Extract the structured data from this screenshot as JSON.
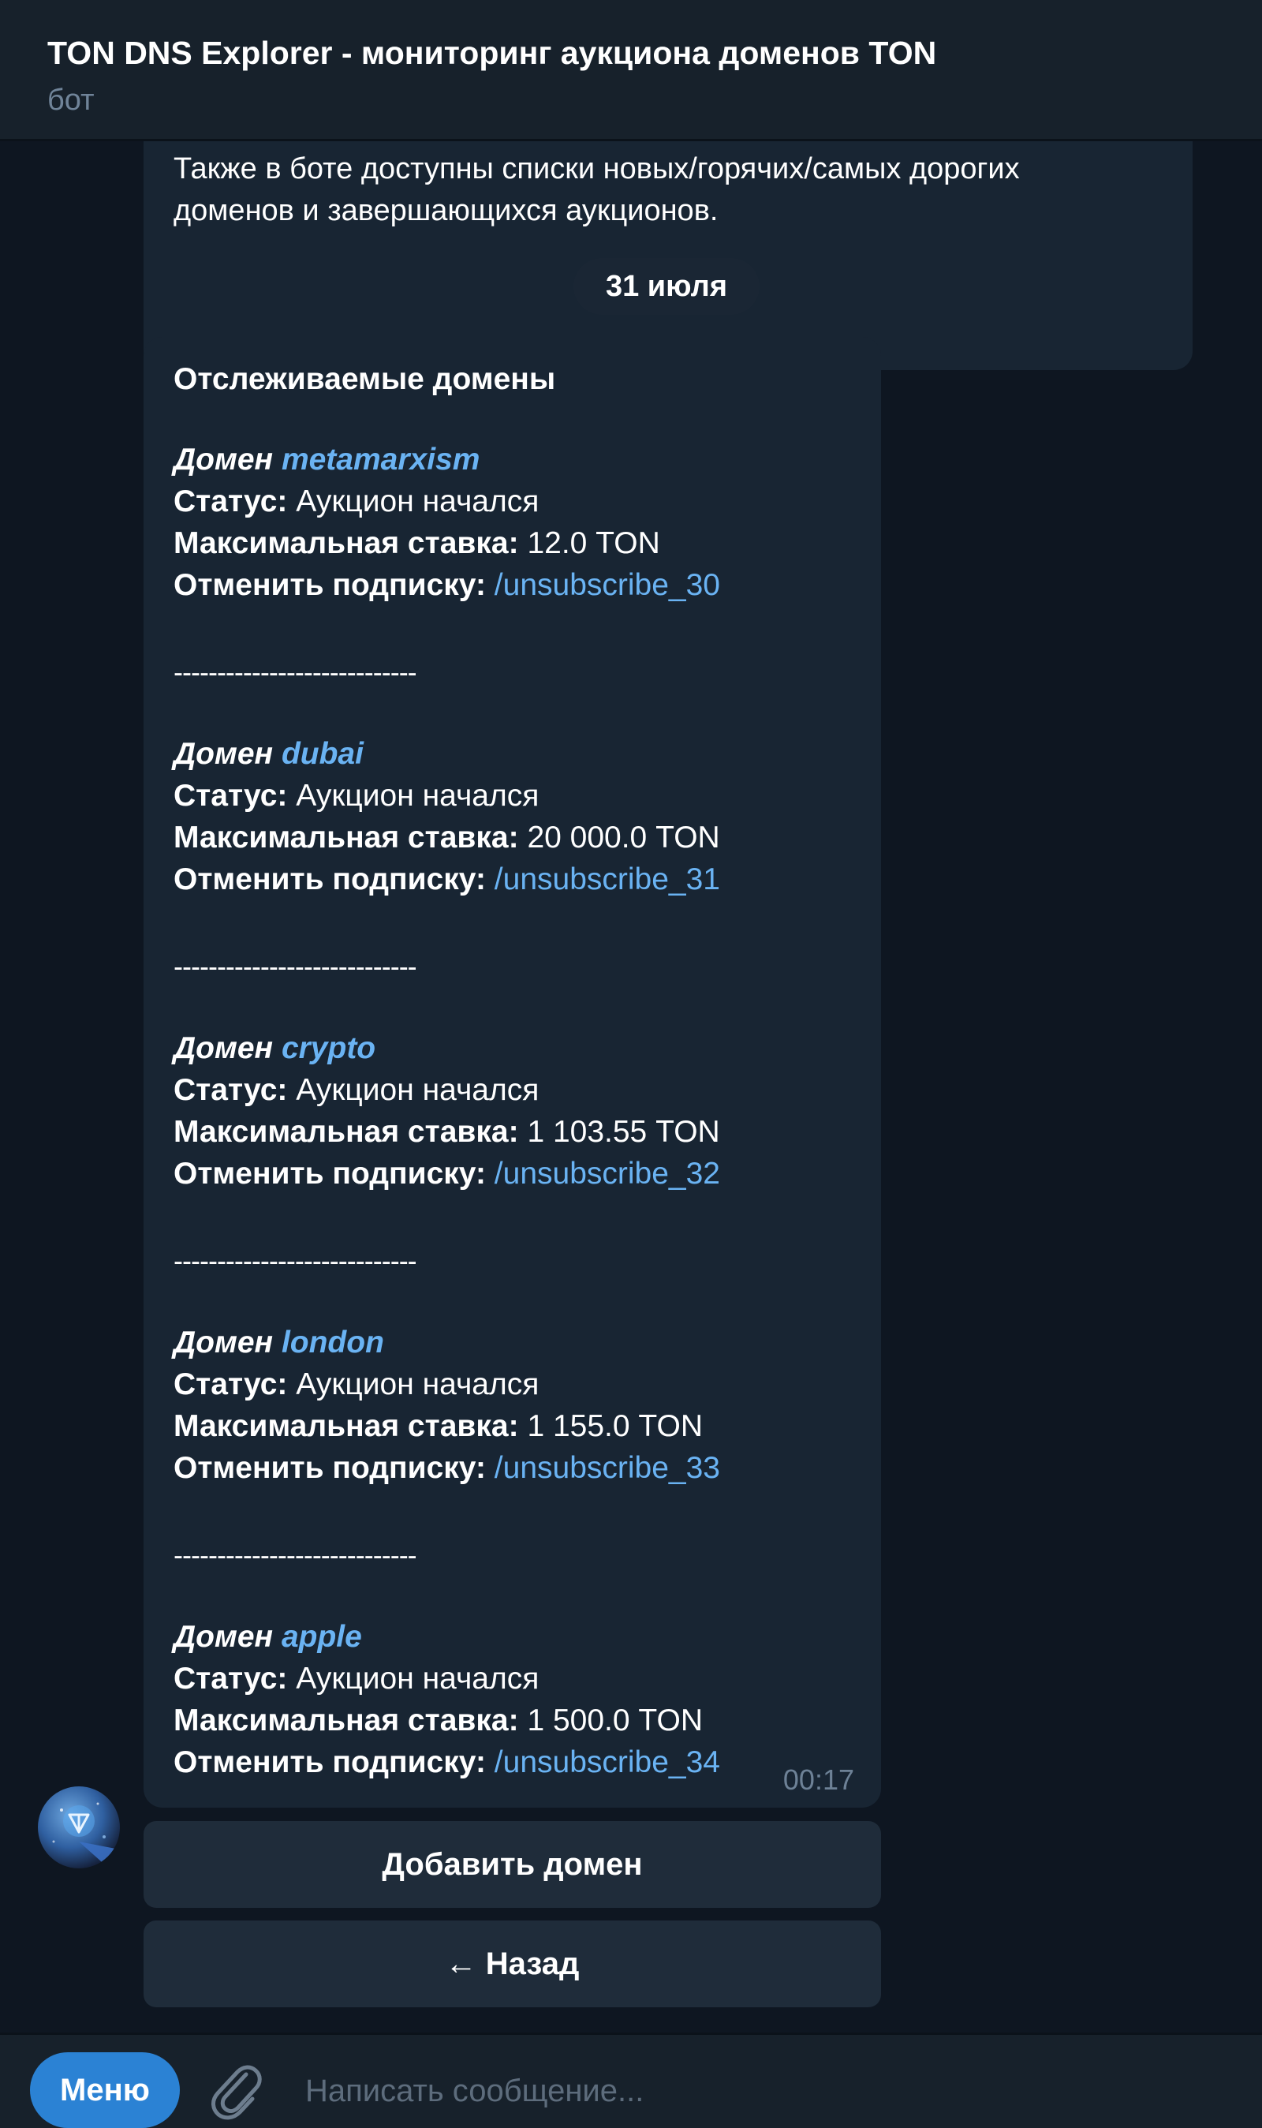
{
  "header": {
    "title": "TON DNS Explorer - мониторинг аукциона доменов TON",
    "subtitle": "бот"
  },
  "previous_message": {
    "line1": "Также в боте доступны списки новых/горячих/самых дорогих",
    "line2": "доменов и завершающихся аукционов."
  },
  "date_separator": "31 июля",
  "message": {
    "heading": "Отслеживаемые домены",
    "domain_label": "Домен",
    "status_label": "Статус:",
    "bid_label": "Максимальная ставка:",
    "unsubscribe_label": "Отменить подписку:",
    "divider": "----------------------------",
    "time": "00:17",
    "domains": [
      {
        "name": "metamarxism",
        "status": "Аукцион начался",
        "max_bid": "12.0 TON",
        "unsubscribe": "/unsubscribe_30"
      },
      {
        "name": "dubai",
        "status": "Аукцион начался",
        "max_bid": "20 000.0 TON",
        "unsubscribe": "/unsubscribe_31"
      },
      {
        "name": "crypto",
        "status": "Аукцион начался",
        "max_bid": "1 103.55 TON",
        "unsubscribe": "/unsubscribe_32"
      },
      {
        "name": "london",
        "status": "Аукцион начался",
        "max_bid": "1 155.0 TON",
        "unsubscribe": "/unsubscribe_33"
      },
      {
        "name": "apple",
        "status": "Аукцион начался",
        "max_bid": "1 500.0 TON",
        "unsubscribe": "/unsubscribe_34"
      }
    ]
  },
  "keyboard": {
    "add_domain": "Добавить домен",
    "back": "← Назад"
  },
  "input_bar": {
    "menu_label": "Меню",
    "placeholder": "Написать сообщение..."
  },
  "colors": {
    "background": "#0e1621",
    "panel": "#17212b",
    "bubble": "#182533",
    "link": "#6ab3f3",
    "menu_button": "#2b82d4"
  },
  "icons": {
    "attach": "paperclip-icon",
    "avatar": "ton-logo-avatar"
  }
}
